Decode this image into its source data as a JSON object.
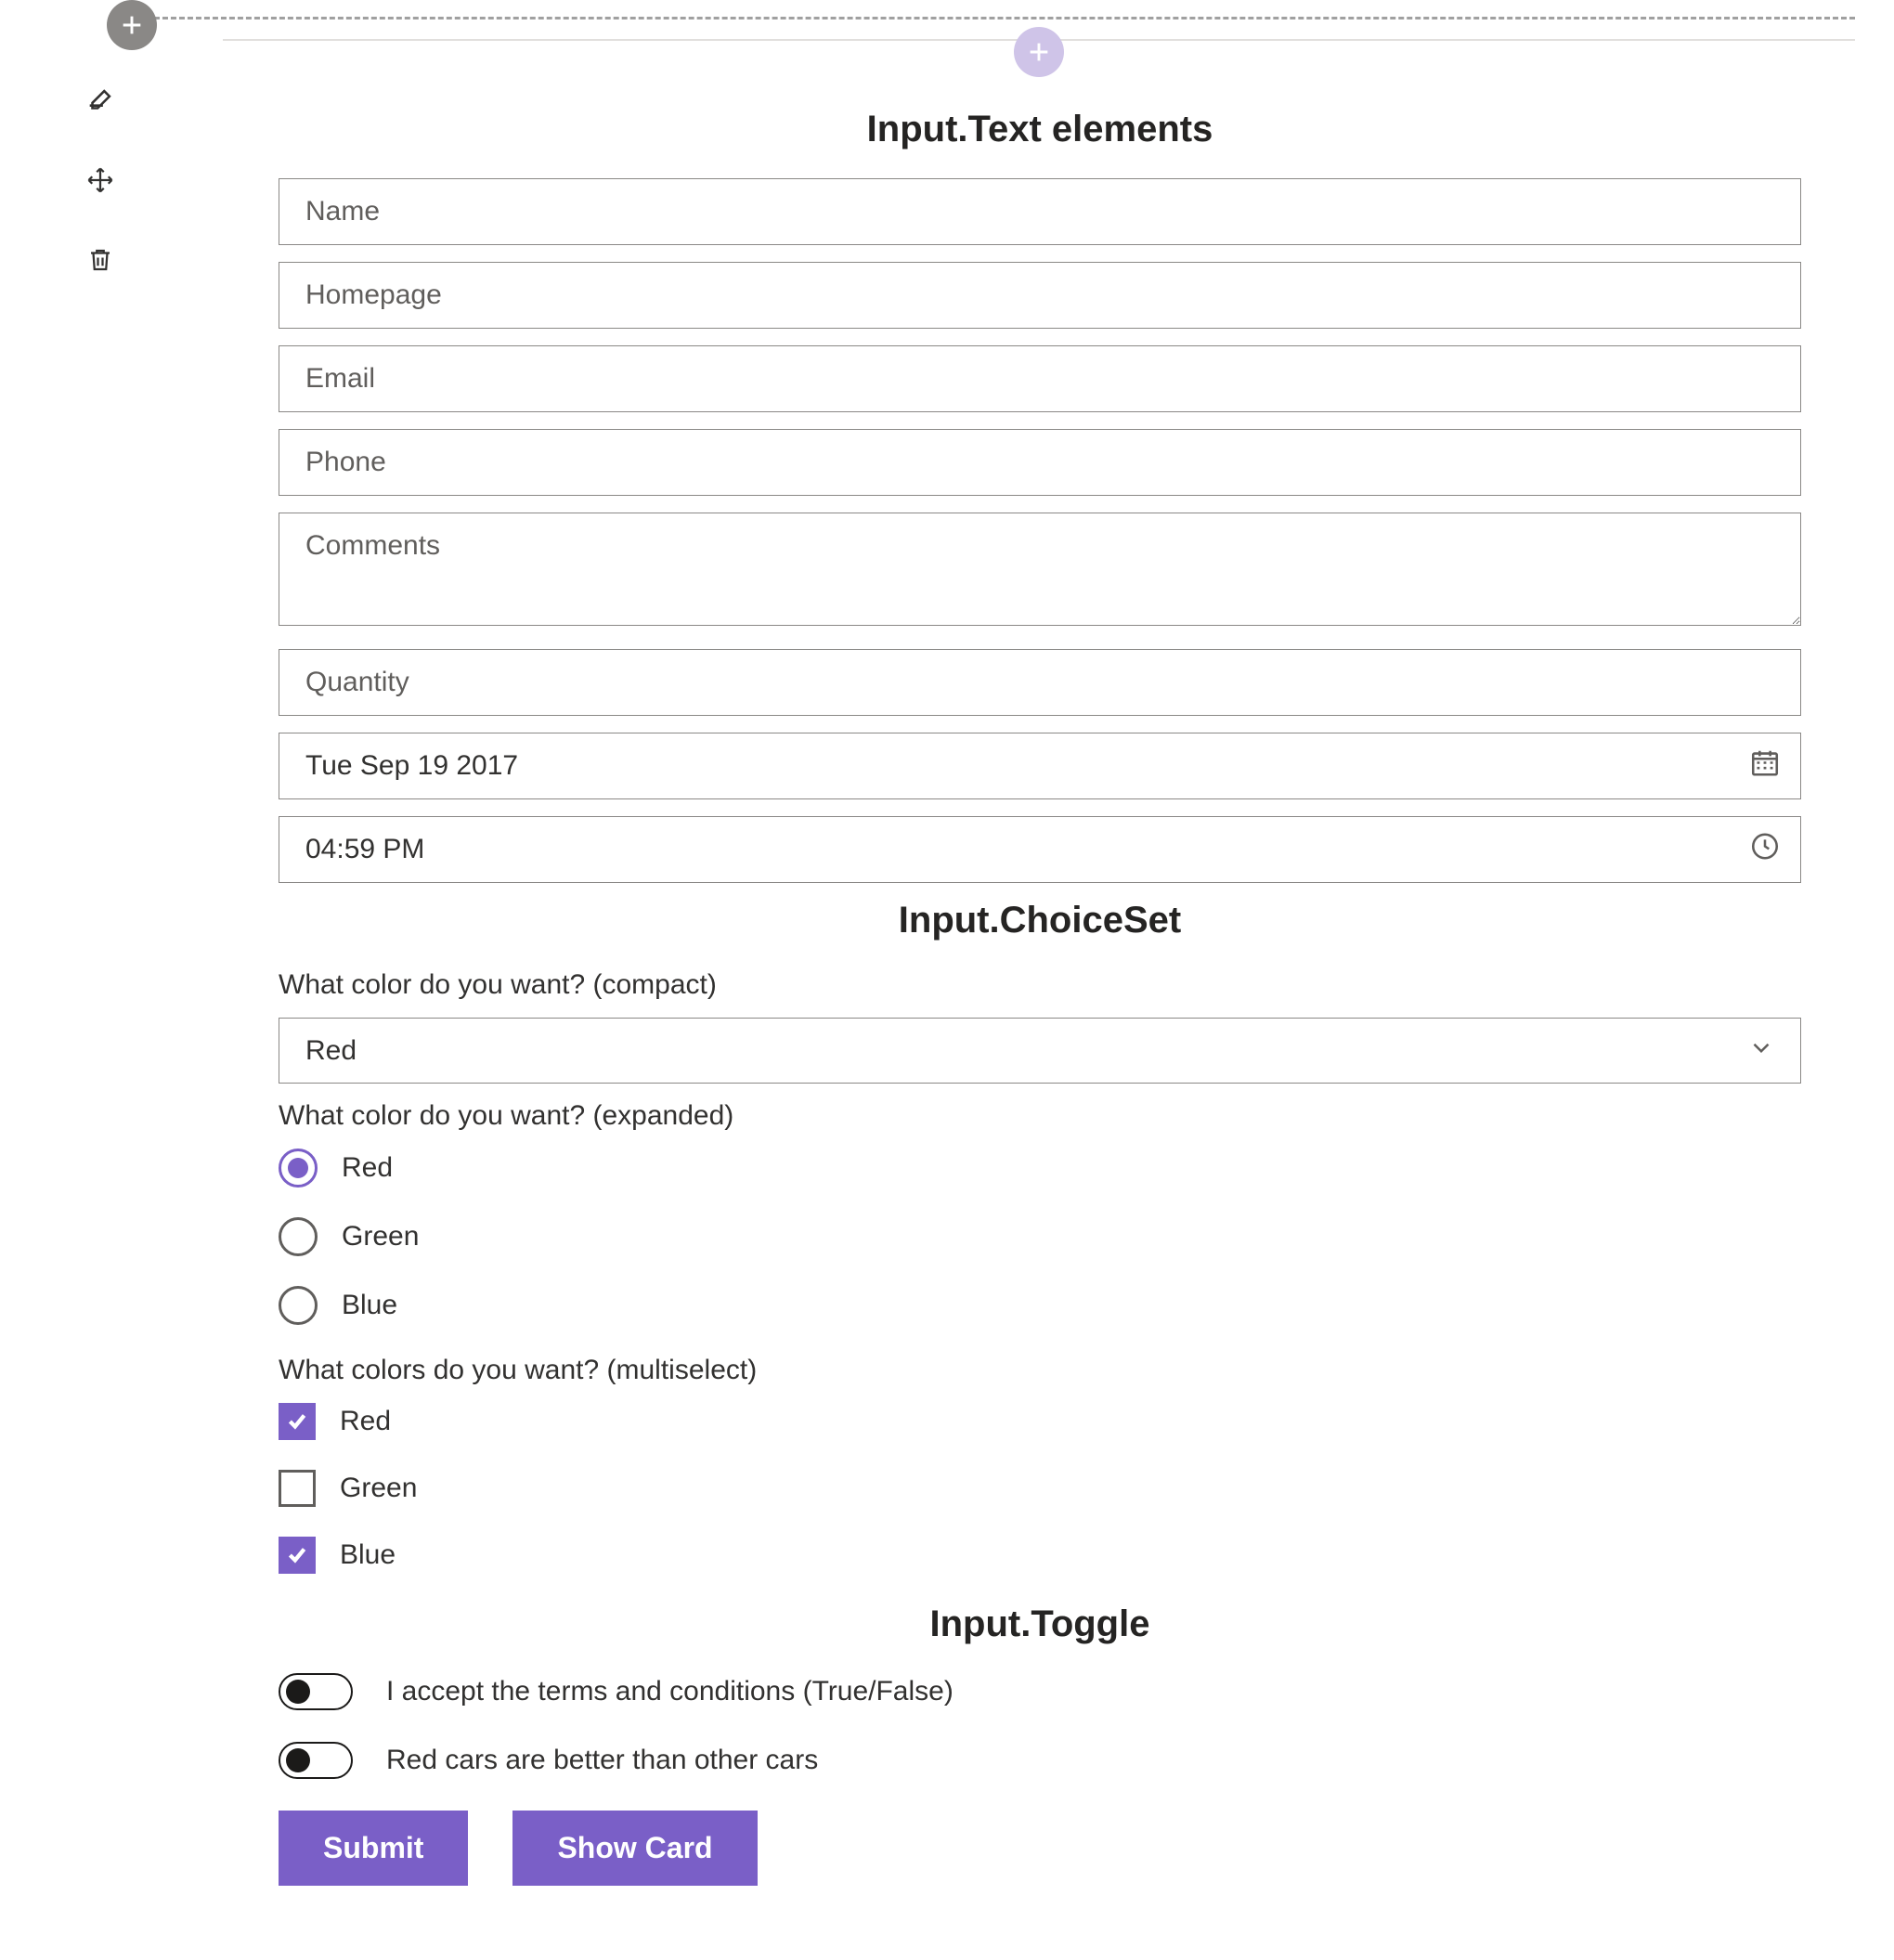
{
  "colors": {
    "accent": "#7a5fc7",
    "border": "#8a8886"
  },
  "sections": {
    "text_title": "Input.Text elements",
    "choice_title": "Input.ChoiceSet",
    "toggle_title": "Input.Toggle"
  },
  "text_inputs": {
    "name": {
      "placeholder": "Name",
      "value": ""
    },
    "homepage": {
      "placeholder": "Homepage",
      "value": ""
    },
    "email": {
      "placeholder": "Email",
      "value": ""
    },
    "phone": {
      "placeholder": "Phone",
      "value": ""
    },
    "comments": {
      "placeholder": "Comments",
      "value": ""
    },
    "quantity": {
      "placeholder": "Quantity",
      "value": ""
    },
    "date": {
      "value": "Tue Sep 19 2017"
    },
    "time": {
      "value": "04:59 PM"
    }
  },
  "choice": {
    "compact_prompt": "What color do you want? (compact)",
    "compact_value": "Red",
    "expanded_prompt": "What color do you want? (expanded)",
    "expanded_options": [
      {
        "label": "Red",
        "selected": true
      },
      {
        "label": "Green",
        "selected": false
      },
      {
        "label": "Blue",
        "selected": false
      }
    ],
    "multi_prompt": "What colors do you want? (multiselect)",
    "multi_options": [
      {
        "label": "Red",
        "checked": true
      },
      {
        "label": "Green",
        "checked": false
      },
      {
        "label": "Blue",
        "checked": true
      }
    ]
  },
  "toggles": [
    {
      "label": "I accept the terms and conditions (True/False)",
      "checked": false
    },
    {
      "label": "Red cars are better than other cars",
      "checked": false
    }
  ],
  "actions": {
    "submit": "Submit",
    "show_card": "Show Card"
  }
}
